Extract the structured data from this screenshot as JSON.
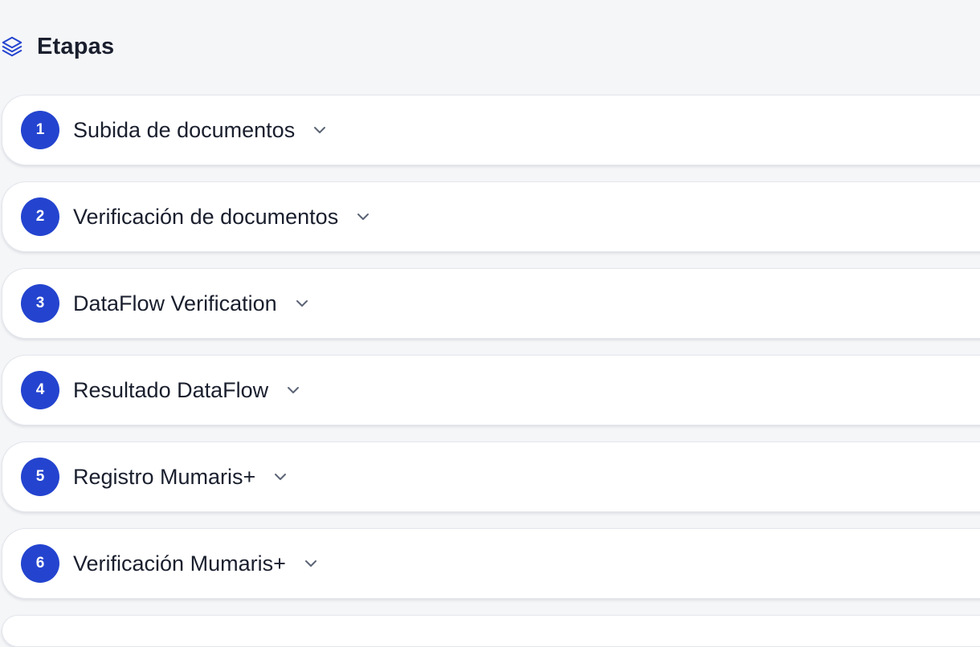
{
  "header": {
    "title": "Etapas",
    "icon": "layers-icon",
    "accent_color": "#2444cf"
  },
  "stages": [
    {
      "number": "1",
      "label": "Subida de documentos"
    },
    {
      "number": "2",
      "label": "Verificación de documentos"
    },
    {
      "number": "3",
      "label": "DataFlow Verification"
    },
    {
      "number": "4",
      "label": "Resultado DataFlow"
    },
    {
      "number": "5",
      "label": "Registro Mumaris+"
    },
    {
      "number": "6",
      "label": "Verificación Mumaris+"
    }
  ],
  "icons": {
    "expand": "chevron-down-icon"
  }
}
